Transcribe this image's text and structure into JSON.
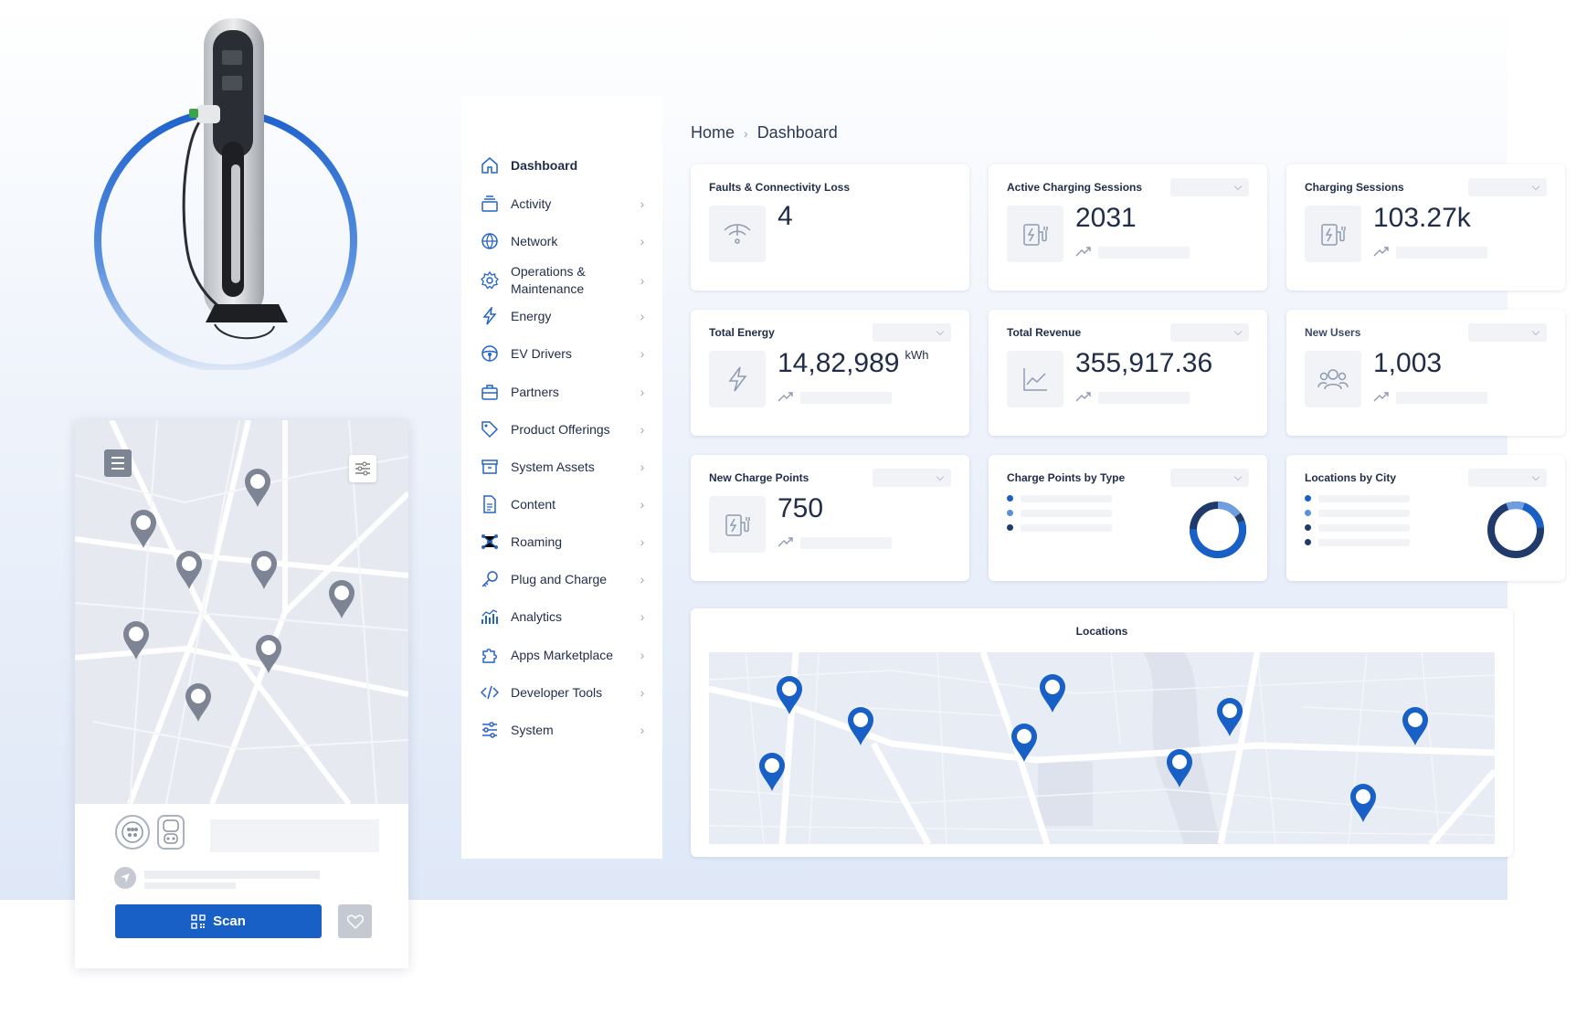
{
  "breadcrumb": {
    "home": "Home",
    "current": "Dashboard"
  },
  "sidebar": {
    "items": [
      {
        "label": "Dashboard",
        "icon": "home-icon",
        "active": true
      },
      {
        "label": "Activity",
        "icon": "layers-icon"
      },
      {
        "label": "Network",
        "icon": "globe-icon"
      },
      {
        "label": "Operations &\nMaintenance",
        "icon": "gear-icon"
      },
      {
        "label": "Energy",
        "icon": "lightning-icon"
      },
      {
        "label": "EV Drivers",
        "icon": "steering-wheel-icon"
      },
      {
        "label": "Partners",
        "icon": "briefcase-icon"
      },
      {
        "label": "Product Offerings",
        "icon": "tag-icon"
      },
      {
        "label": "System Assets",
        "icon": "archive-icon"
      },
      {
        "label": "Content",
        "icon": "document-icon"
      },
      {
        "label": "Roaming",
        "icon": "network-nodes-icon"
      },
      {
        "label": "Plug and Charge",
        "icon": "key-icon"
      },
      {
        "label": "Analytics",
        "icon": "analytics-icon"
      },
      {
        "label": "Apps Marketplace",
        "icon": "puzzle-icon"
      },
      {
        "label": "Developer Tools",
        "icon": "code-icon"
      },
      {
        "label": "System",
        "icon": "sliders-icon"
      }
    ]
  },
  "cards": {
    "faults": {
      "title": "Faults & Connectivity Loss",
      "value": "4"
    },
    "active_sessions": {
      "title": "Active Charging Sessions",
      "value": "2031"
    },
    "sessions": {
      "title": "Charging Sessions",
      "value": "103.27k"
    },
    "energy": {
      "title": "Total Energy",
      "value": "14,82,989",
      "unit": "kWh"
    },
    "revenue": {
      "title": "Total Revenue",
      "value": "355,917.36"
    },
    "new_users": {
      "title": "New Users",
      "value": "1,003"
    },
    "new_points": {
      "title": "New Charge Points",
      "value": "750"
    },
    "by_type": {
      "title": "Charge Points by Type"
    },
    "by_city": {
      "title": "Locations by City"
    }
  },
  "locations": {
    "title": "Locations"
  },
  "mobile": {
    "scan_label": "Scan"
  },
  "colors": {
    "accent": "#1860c6",
    "ring": "#2f6fd0",
    "text": "#1f2d48"
  }
}
